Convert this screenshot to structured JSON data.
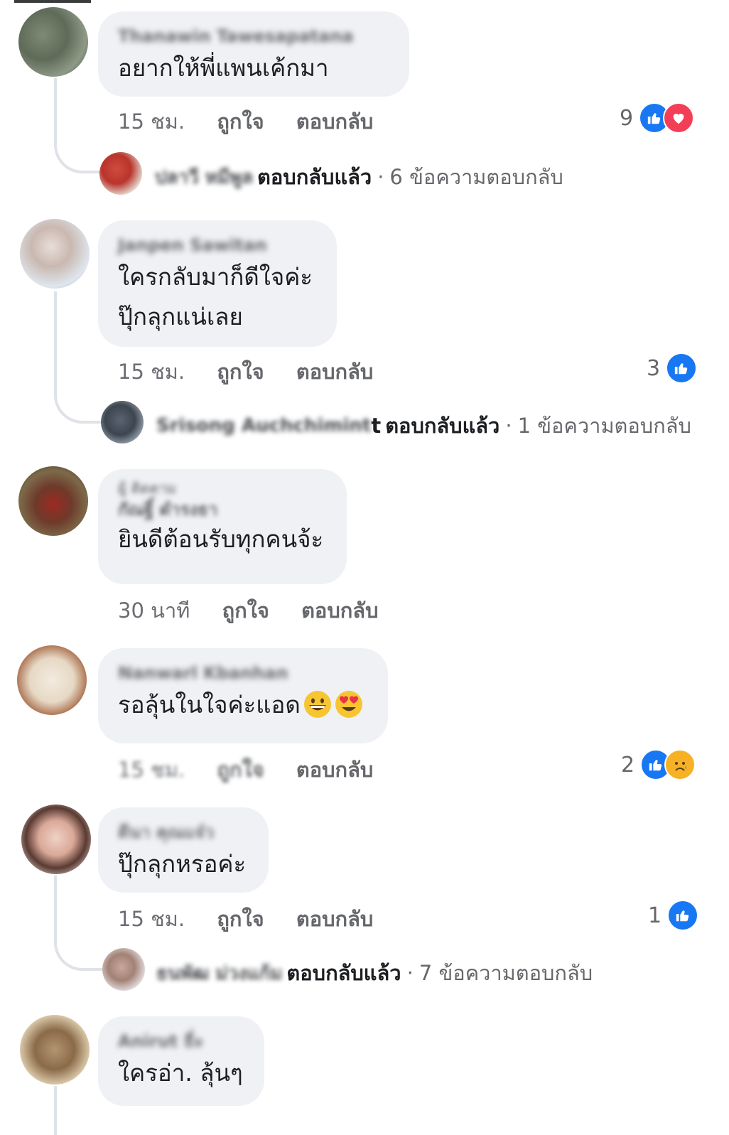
{
  "comments": [
    {
      "author": "Thanawin Tawesapatana",
      "text_lines": [
        "อยากให้พี่แพนเค้กมา"
      ],
      "time": "15 ชม.",
      "like_label": "ถูกใจ",
      "reply_label": "ตอบกลับ",
      "reaction_count": "9",
      "reactions": [
        "like",
        "love"
      ],
      "reply_summary": {
        "author": "ปลาวี หมีพูล",
        "replied_label": "ตอบกลับแล้ว",
        "count_text": "6 ข้อความตอบกลับ"
      }
    },
    {
      "author": "Janpen Sawitan",
      "text_lines": [
        "ใครกลับมาก็ดีใจค่ะ",
        "ปุ๊กลุกแน่เลย"
      ],
      "time": "15 ชม.",
      "like_label": "ถูกใจ",
      "reply_label": "ตอบกลับ",
      "reaction_count": "3",
      "reactions": [
        "like"
      ],
      "reply_summary": {
        "author": "Srisong Auchchimint",
        "author_tail": "t",
        "replied_label": "ตอบกลับแล้ว",
        "count_text": "1 ข้อความตอบกลับ"
      }
    },
    {
      "author_line1": "ผู้ ติดตาม",
      "author": "กัณฐิ์ ดำรงธา",
      "text_lines": [
        "ยินดีต้อนรับทุกคนจ้ะ"
      ],
      "time": "30 นาที",
      "like_label": "ถูกใจ",
      "reply_label": "ตอบกลับ"
    },
    {
      "author": "Nanwarl Kbanhan",
      "text_lines": [
        "รอลุ้นในใจค่ะแอด"
      ],
      "time": "15 ชม.",
      "like_label": "ถูกใจ",
      "reply_label": "ตอบกลับ",
      "reaction_count": "2",
      "reactions": [
        "like",
        "sad"
      ]
    },
    {
      "author": "ดีนา คุณแจ๋ว",
      "text_lines": [
        "ปุ๊กลุกหรอค่ะ"
      ],
      "time": "15 ชม.",
      "like_label": "ถูกใจ",
      "reply_label": "ตอบกลับ",
      "reaction_count": "1",
      "reactions": [
        "like"
      ],
      "reply_summary": {
        "author": "ธนพัฒ ม่วงแก้ม",
        "replied_label": "ตอบกลับแล้ว",
        "count_text": "7 ข้อความตอบกลับ"
      }
    },
    {
      "author": "Anirut ธี่ะ",
      "text_lines": [
        "ใครอ่า. ลุ้นๆ"
      ]
    }
  ],
  "colors": {
    "like": "#1877f2",
    "love": "#f33e58",
    "sad": "#f7b125",
    "bubble": "#eff1f4"
  }
}
